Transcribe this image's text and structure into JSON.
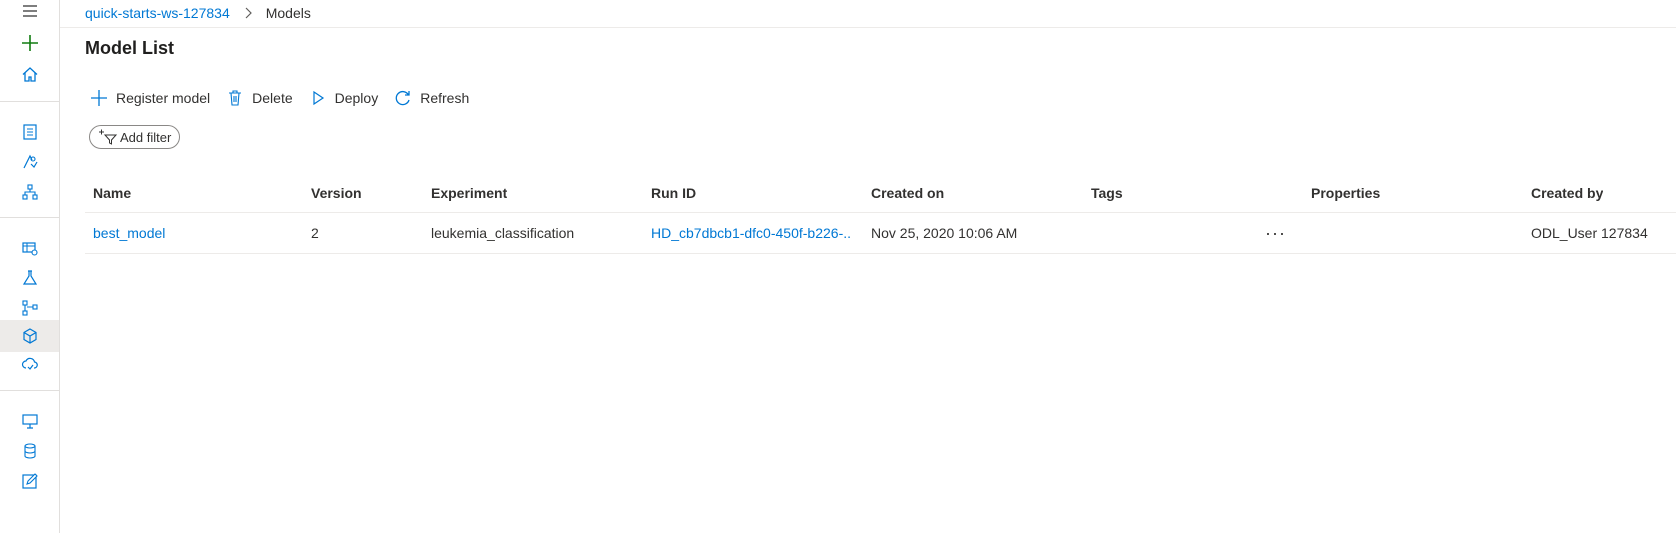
{
  "sidebar": {
    "items": [
      {
        "icon": "hamburger-icon"
      },
      {
        "icon": "plus-icon"
      },
      {
        "icon": "home-icon"
      },
      {
        "icon": "notebook-icon"
      },
      {
        "icon": "automated-ml-icon"
      },
      {
        "icon": "designer-icon"
      },
      {
        "icon": "datasets-icon"
      },
      {
        "icon": "experiments-icon"
      },
      {
        "icon": "pipelines-icon"
      },
      {
        "icon": "models-icon",
        "active": true
      },
      {
        "icon": "endpoints-icon"
      },
      {
        "icon": "compute-icon"
      },
      {
        "icon": "datastores-icon"
      },
      {
        "icon": "data-labeling-icon"
      }
    ]
  },
  "breadcrumb": {
    "workspace": "quick-starts-ws-127834",
    "current": "Models"
  },
  "page": {
    "title": "Model List"
  },
  "toolbar": {
    "register_label": "Register model",
    "delete_label": "Delete",
    "deploy_label": "Deploy",
    "refresh_label": "Refresh"
  },
  "filter": {
    "add_label": "Add filter"
  },
  "table": {
    "columns": [
      "Name",
      "Version",
      "Experiment",
      "Run ID",
      "Created on",
      "Tags",
      "Properties",
      "Created by"
    ],
    "rows": [
      {
        "name": "best_model",
        "version": "2",
        "experiment": "leukemia_classification",
        "run_id": "HD_cb7dbcb1-dfc0-450f-b226-...",
        "created_on": "Nov 25, 2020 10:06 AM",
        "tags": "",
        "properties_more": "···",
        "created_by": "ODL_User 127834"
      }
    ]
  },
  "colors": {
    "accent": "#0078d4",
    "add_green": "#107c10",
    "text": "#323130"
  }
}
